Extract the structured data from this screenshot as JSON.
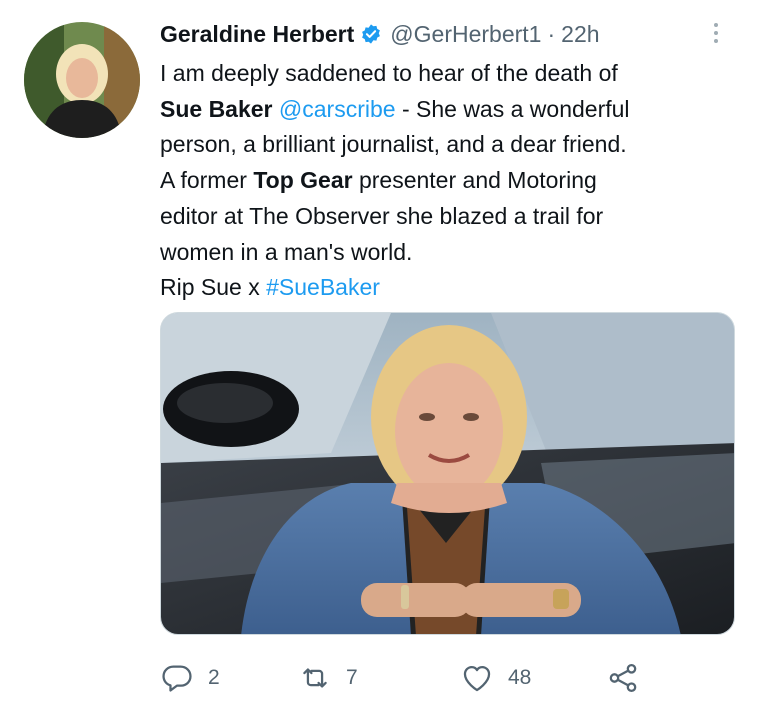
{
  "tweet": {
    "author": {
      "display_name": "Geraldine Herbert",
      "handle": "@GerHerbert1",
      "verified": true,
      "avatar": "avatar-photo"
    },
    "separator": "·",
    "time": "22h",
    "text_lines": [
      [
        {
          "t": "I am deeply saddened to hear of the death of"
        }
      ],
      [
        {
          "t": "Sue Baker",
          "style": "bold"
        },
        {
          "t": " "
        },
        {
          "t": "@carscribe",
          "style": "link"
        },
        {
          "t": " - She was a wonderful"
        }
      ],
      [
        {
          "t": "person, a brilliant journalist, and a dear friend."
        }
      ],
      [
        {
          "t": "A former "
        },
        {
          "t": "Top Gear",
          "style": "bold"
        },
        {
          "t": " presenter and Motoring"
        }
      ],
      [
        {
          "t": "editor at The Observer she blazed a trail for"
        }
      ],
      [
        {
          "t": "women in a man's world."
        }
      ],
      [
        {
          "t": "Rip Sue x "
        },
        {
          "t": "#SueBaker",
          "style": "link"
        }
      ]
    ],
    "media": {
      "kind": "photo",
      "subject": "woman-leaning-on-car-photo"
    },
    "actions": {
      "reply": {
        "icon": "reply-icon",
        "count": "2"
      },
      "retweet": {
        "icon": "retweet-icon",
        "count": "7"
      },
      "like": {
        "icon": "heart-icon",
        "count": "48"
      },
      "share": {
        "icon": "share-icon"
      }
    }
  },
  "colors": {
    "text": "#0f1419",
    "secondary": "#536471",
    "link": "#1d9bf0",
    "verified": "#1d9bf0"
  }
}
